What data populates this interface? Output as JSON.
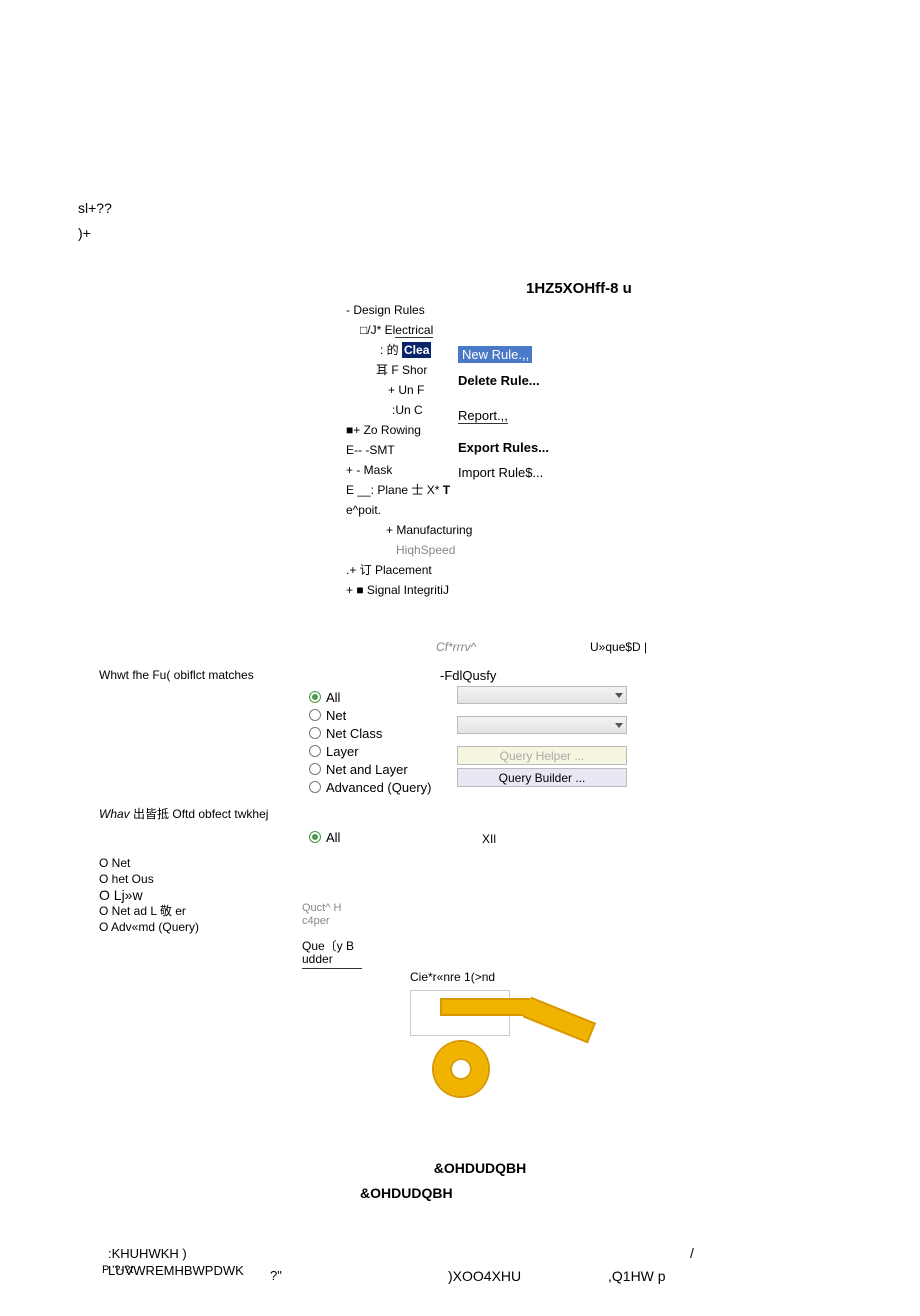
{
  "top": {
    "line1": "sl+??",
    "line2": ")+"
  },
  "dialog": {
    "title": "1HZ5XOHff-8 u"
  },
  "tree": {
    "r0": "- Design Rules",
    "r1_pre": "□/J* El",
    "r1_link": "ectrical",
    "r2_pre": ": 的 ",
    "r2_hl": "Clea",
    "r3": "耳 F Shor",
    "r4": "+ Un F",
    "r5": ":Un C",
    "r6": "■+ Zo Rowing",
    "r7": "E-- -SMT",
    "r8": "+    - Mask",
    "r9_a": "E __:    Plane 士 X* ",
    "r9_b": "T",
    "r10": "e^poit.",
    "r11": "+ Manufacturing",
    "r12": "HiqhSpeed",
    "r13": ".+ 订 Placement",
    "r14": "+    ■ Signal IntegritiJ"
  },
  "menu": {
    "new": "New Rule.,,",
    "delete": "Delete Rule...",
    "report": "Report.,,",
    "export": "Export Rules...",
    "import": "Import Rule$..."
  },
  "mid": {
    "comment": "Cf*rrrv^",
    "unique": "U»que$D |"
  },
  "first": {
    "title": "Whwt fhe Fu( obiflct matches",
    "full_query": "-FdlQusfy",
    "opts": [
      "All",
      "Net",
      "Net Class",
      "Layer",
      "Net and Layer",
      "Advanced (Query)"
    ],
    "helper": "Query Helper ...",
    "builder": "Query Builder ..."
  },
  "second": {
    "title_a": "Whav ",
    "title_b": "出皆抵 ",
    "title_c": "Oftd obfect twkhej",
    "all": "All",
    "xll": "XIl",
    "list": [
      "O Net",
      "O het Ous",
      "O Lj»w",
      "O Net ad L 敬 er",
      "O Adv«md (Query)"
    ],
    "helper1": "Quct^ H",
    "helper2": "c4per",
    "builder1": "Que〔y B",
    "builder2": "udder"
  },
  "clearance": {
    "heading": "Cie*r«nre 1(>nd",
    "label1": "&OHDUDQBH",
    "label2": "&OHDUDQBH"
  },
  "footer": {
    "l1": ":KHUHWKH )",
    "l2": "LUVWREMHBWPDWK",
    "l3": "P '?-?t",
    "slash": "/",
    "q": "?\"",
    "mid": ")XOO4XHU",
    "right": ",Q1HW p"
  }
}
